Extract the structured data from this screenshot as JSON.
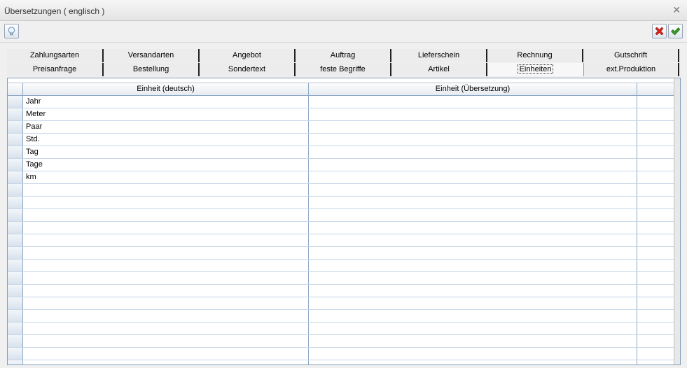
{
  "window": {
    "title": "Übersetzungen ( englisch )"
  },
  "icons": {
    "close": "close-icon",
    "hint": "lightbulb-icon",
    "cancel": "red-x-icon",
    "confirm": "green-check-icon"
  },
  "colors": {
    "cancel": "#d9261c",
    "confirm": "#3a9a21",
    "grid_line": "#8fa8c4"
  },
  "tabs": {
    "row1": [
      "Zahlungsarten",
      "Versandarten",
      "Angebot",
      "Auftrag",
      "Lieferschein",
      "Rechnung",
      "Gutschrift"
    ],
    "row2": [
      "Preisanfrage",
      "Bestellung",
      "Sondertext",
      "feste Begriffe",
      "Artikel",
      "Einheiten",
      "ext.Produktion"
    ],
    "active": "Einheiten"
  },
  "grid": {
    "columns": [
      "Einheit (deutsch)",
      "Einheit (Übersetzung)",
      ""
    ],
    "rows": [
      [
        "Jahr",
        ""
      ],
      [
        "Meter",
        ""
      ],
      [
        "Paar",
        ""
      ],
      [
        "Std.",
        ""
      ],
      [
        "Tag",
        ""
      ],
      [
        "Tage",
        ""
      ],
      [
        "km",
        ""
      ],
      [
        "",
        ""
      ],
      [
        "",
        ""
      ],
      [
        "",
        ""
      ],
      [
        "",
        ""
      ],
      [
        "",
        ""
      ],
      [
        "",
        ""
      ],
      [
        "",
        ""
      ],
      [
        "",
        ""
      ],
      [
        "",
        ""
      ],
      [
        "",
        ""
      ],
      [
        "",
        ""
      ],
      [
        "",
        ""
      ],
      [
        "",
        ""
      ],
      [
        "",
        ""
      ],
      [
        "",
        ""
      ],
      [
        "",
        ""
      ]
    ]
  }
}
